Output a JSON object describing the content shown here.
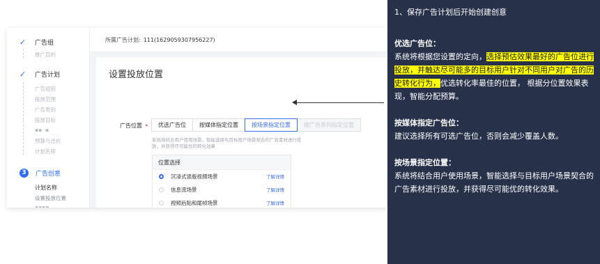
{
  "sidebar": {
    "steps": [
      {
        "title": "广告组",
        "subs": [
          "推广目的"
        ]
      },
      {
        "title": "广告计划",
        "subs": [
          "广告组别",
          "投放范围",
          "广告类别",
          "投放目标",
          "预算与出价",
          "计划名称"
        ]
      },
      {
        "number": "3",
        "title": "广告创意",
        "subs": [
          "计划名称",
          "设置投放位置"
        ]
      }
    ]
  },
  "topbar": {
    "label": "所属广告计划:",
    "value": "111(1629059307956227)"
  },
  "form": {
    "heading": "设置投放位置",
    "field_label": "广告位置",
    "required_mark": "•",
    "tabs": [
      "优选广告位",
      "按媒体指定位置",
      "按场景指定位置",
      "按广告系列指定位置"
    ],
    "selected_tab": "按场景指定位置",
    "hint": "系统将结合用户使用场景，智能选择与目标用户场景契合的广告素材进行投放，并获得尽可能优的转化效果",
    "panel_title": "位置选择",
    "options": [
      {
        "label": "沉浸式竖版视频场景",
        "link": "了解详情",
        "selected": true
      },
      {
        "label": "信息流场景",
        "link": "了解详情",
        "selected": false
      },
      {
        "label": "视频后贴和尾帧场景",
        "link": "了解详情",
        "selected": false
      }
    ]
  },
  "notes": {
    "intro": "1、保存广告计划后开始创建创意",
    "s1_head": "优选广告位：",
    "s1_a": "系统将根据您设置的定向，",
    "s1_hl": "选择预估效果最好的广告位进行投放，并触达尽可能多的目标用户针对不同用户对广告的历史转化行为，",
    "s1_b": "优选转化率最佳的位置， 根据分位置效果表现，智能分配预算。",
    "s2_head": "按媒体指定广告位：",
    "s2_text": "建议选择所有可选广告位，否则会减少覆盖人数。",
    "s3_head": "按场景指定位置：",
    "s3_text": "系统将结合用户使用场景，智能选择与目标用户场景契合的广告素材进行投放，并获得尽可能优的转化效果。"
  },
  "colors": {
    "accent": "#3a6fe8",
    "note_bg": "#27324a",
    "highlight": "#ffff00"
  }
}
